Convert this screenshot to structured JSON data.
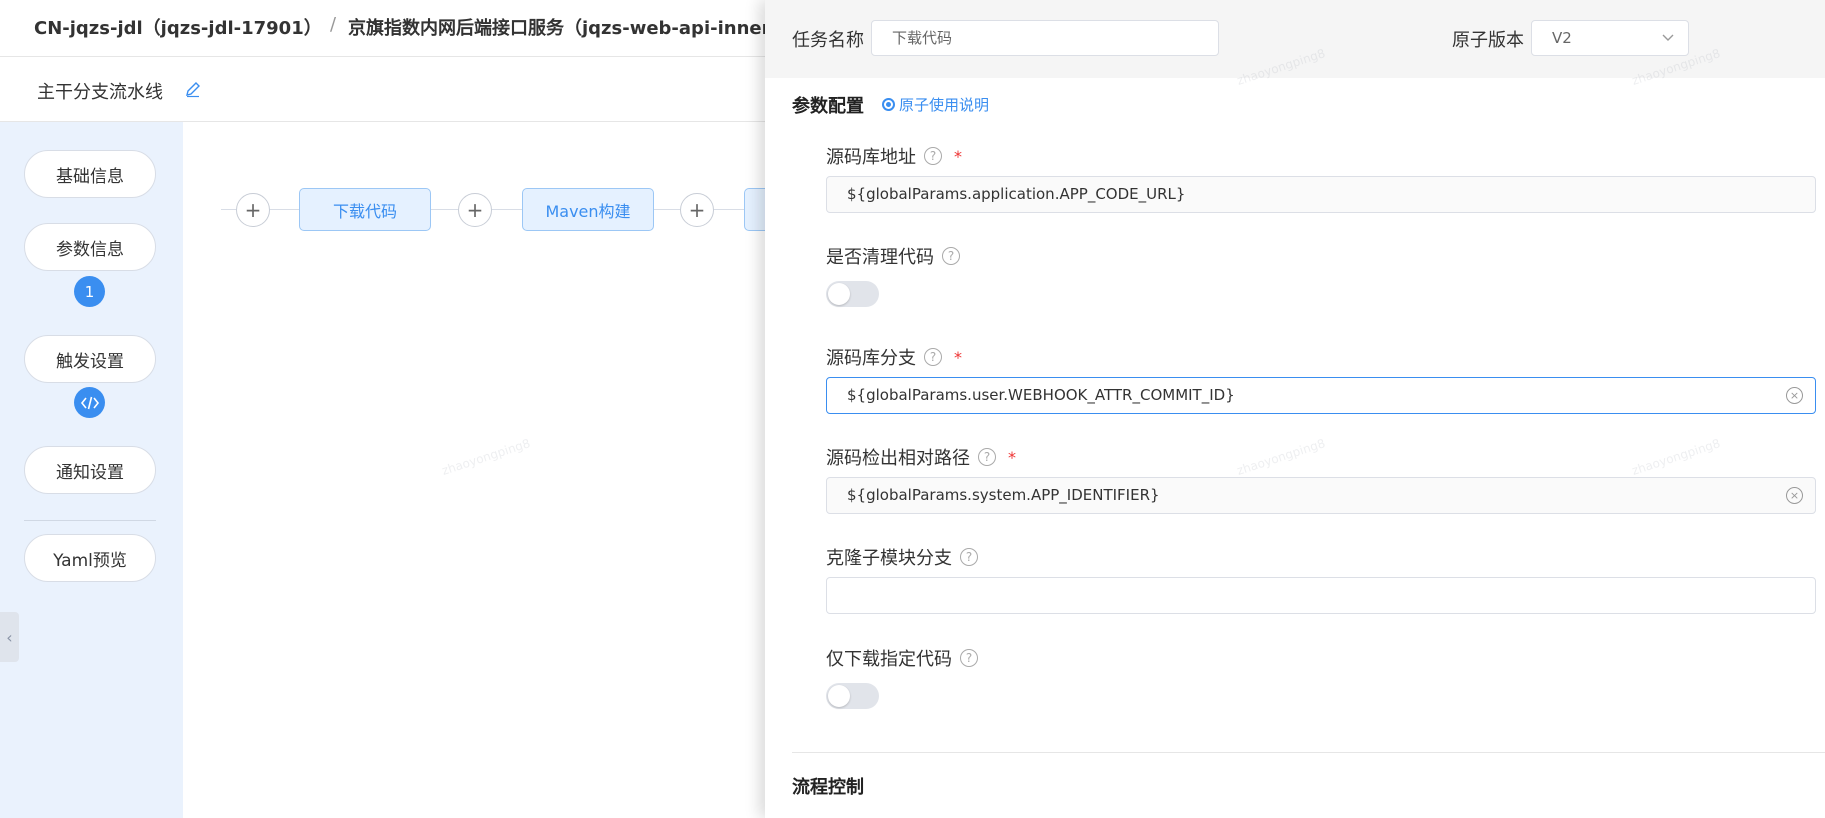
{
  "header": {
    "crumb_app": "CN-jqzs-jdl（jqzs-jdl-17901）",
    "crumb_sep": "/",
    "crumb_service": "京旗指数内网后端接口服务（jqzs-web-api-inner"
  },
  "subheader": {
    "pipeline_name": "主干分支流水线",
    "edit_icon": "pencil-icon"
  },
  "leftnav": {
    "items": [
      {
        "label": "基础信息"
      },
      {
        "label": "参数信息",
        "badge": "1"
      },
      {
        "label": "触发设置",
        "badge_icon": "code-icon"
      },
      {
        "label": "通知设置"
      },
      {
        "label": "Yaml预览"
      }
    ],
    "collapse_icon": "chevron-left-icon"
  },
  "canvas": {
    "plus_label": "+",
    "stages": [
      "下载代码",
      "Maven构建"
    ]
  },
  "drawer": {
    "task_name_label": "任务名称",
    "task_name_value": "下载代码",
    "atom_version_label": "原子版本",
    "atom_version_value": "V2",
    "param_section_title": "参数配置",
    "atom_help_link": "原子使用说明",
    "fields": {
      "repo_url": {
        "label": "源码库地址",
        "value": "${globalParams.application.APP_CODE_URL}"
      },
      "clean_code": {
        "label": "是否清理代码"
      },
      "repo_branch": {
        "label": "源码库分支",
        "value": "${globalParams.user.WEBHOOK_ATTR_COMMIT_ID}"
      },
      "checkout_path": {
        "label": "源码检出相对路径",
        "value": "${globalParams.system.APP_IDENTIFIER}"
      },
      "submodule_branch": {
        "label": "克隆子模块分支",
        "value": ""
      },
      "download_specified": {
        "label": "仅下载指定代码"
      }
    },
    "flow_control_title": "流程控制",
    "required_mark": "*",
    "help_mark": "?",
    "clear_mark": "×"
  },
  "colors": {
    "accent": "#3a8ef0",
    "nav_bg": "#eaf2fd",
    "required": "#ee3333"
  }
}
